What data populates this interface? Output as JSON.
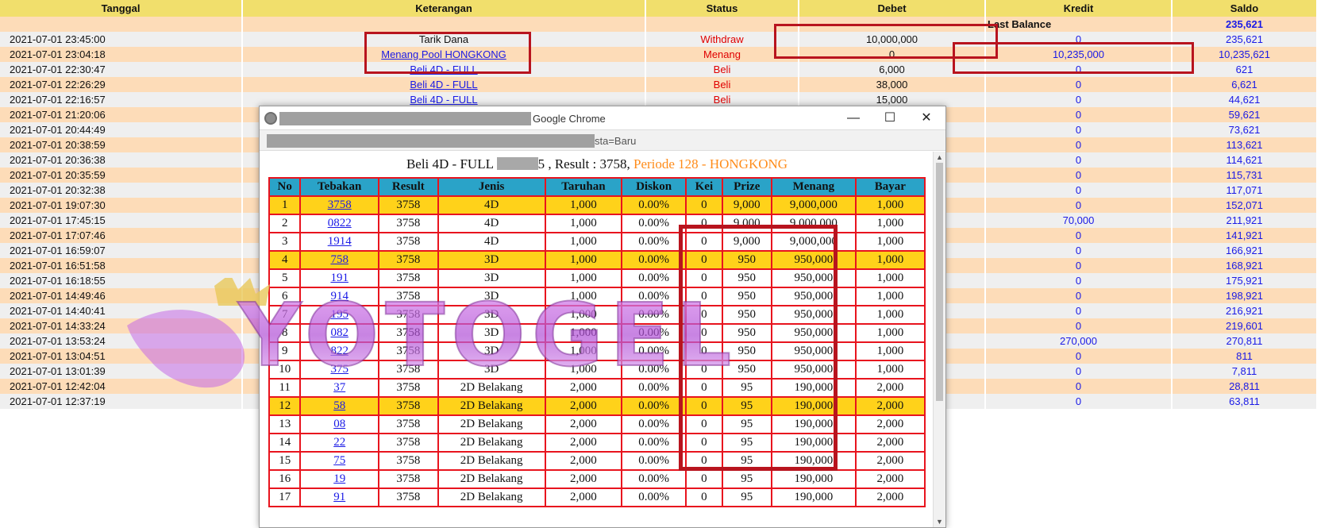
{
  "ledger": {
    "headers": [
      "Tanggal",
      "Keterangan",
      "Status",
      "Debet",
      "Kredit",
      "Saldo"
    ],
    "last_balance": {
      "label": "Last Balance",
      "value": "235,621"
    },
    "rows": [
      {
        "date": "2021-07-01 23:45:00",
        "ket": "Tarik Dana",
        "link": false,
        "status": "Withdraw",
        "debet": "10,000,000",
        "kredit": "0",
        "saldo": "235,621"
      },
      {
        "date": "2021-07-01 23:04:18",
        "ket": "Menang Pool HONGKONG",
        "link": true,
        "status": "Menang",
        "debet": "0",
        "kredit": "10,235,000",
        "saldo": "10,235,621"
      },
      {
        "date": "2021-07-01 22:30:47",
        "ket": "Beli 4D - FULL",
        "link": true,
        "status": "Beli",
        "debet": "6,000",
        "kredit": "0",
        "saldo": "621"
      },
      {
        "date": "2021-07-01 22:26:29",
        "ket": "Beli 4D - FULL",
        "link": true,
        "status": "Beli",
        "debet": "38,000",
        "kredit": "0",
        "saldo": "6,621"
      },
      {
        "date": "2021-07-01 22:16:57",
        "ket": "Beli 4D - FULL",
        "link": true,
        "status": "Beli",
        "debet": "15,000",
        "kredit": "0",
        "saldo": "44,621"
      },
      {
        "date": "2021-07-01 21:20:06",
        "ket": "",
        "link": false,
        "status": "",
        "debet": "",
        "kredit": "0",
        "saldo": "59,621"
      },
      {
        "date": "2021-07-01 20:44:49",
        "ket": "",
        "link": false,
        "status": "",
        "debet": "",
        "kredit": "0",
        "saldo": "73,621"
      },
      {
        "date": "2021-07-01 20:38:59",
        "ket": "",
        "link": false,
        "status": "",
        "debet": "",
        "kredit": "0",
        "saldo": "113,621"
      },
      {
        "date": "2021-07-01 20:36:38",
        "ket": "",
        "link": false,
        "status": "",
        "debet": "",
        "kredit": "0",
        "saldo": "114,621"
      },
      {
        "date": "2021-07-01 20:35:59",
        "ket": "",
        "link": false,
        "status": "",
        "debet": "",
        "kredit": "0",
        "saldo": "115,731"
      },
      {
        "date": "2021-07-01 20:32:38",
        "ket": "",
        "link": false,
        "status": "",
        "debet": "",
        "kredit": "0",
        "saldo": "117,071"
      },
      {
        "date": "2021-07-01 19:07:30",
        "ket": "",
        "link": false,
        "status": "",
        "debet": "",
        "kredit": "0",
        "saldo": "152,071"
      },
      {
        "date": "2021-07-01 17:45:15",
        "ket": "",
        "link": false,
        "status": "",
        "debet": "",
        "kredit": "70,000",
        "saldo": "211,921"
      },
      {
        "date": "2021-07-01 17:07:46",
        "ket": "",
        "link": false,
        "status": "",
        "debet": "",
        "kredit": "0",
        "saldo": "141,921"
      },
      {
        "date": "2021-07-01 16:59:07",
        "ket": "",
        "link": false,
        "status": "",
        "debet": "",
        "kredit": "0",
        "saldo": "166,921"
      },
      {
        "date": "2021-07-01 16:51:58",
        "ket": "",
        "link": false,
        "status": "",
        "debet": "",
        "kredit": "0",
        "saldo": "168,921"
      },
      {
        "date": "2021-07-01 16:18:55",
        "ket": "",
        "link": false,
        "status": "",
        "debet": "",
        "kredit": "0",
        "saldo": "175,921"
      },
      {
        "date": "2021-07-01 14:49:46",
        "ket": "",
        "link": false,
        "status": "",
        "debet": "",
        "kredit": "0",
        "saldo": "198,921"
      },
      {
        "date": "2021-07-01 14:40:41",
        "ket": "",
        "link": false,
        "status": "",
        "debet": "",
        "kredit": "0",
        "saldo": "216,921"
      },
      {
        "date": "2021-07-01 14:33:24",
        "ket": "",
        "link": false,
        "status": "",
        "debet": "",
        "kredit": "0",
        "saldo": "219,601"
      },
      {
        "date": "2021-07-01 13:53:24",
        "ket": "",
        "link": false,
        "status": "",
        "debet": "",
        "kredit": "270,000",
        "saldo": "270,811"
      },
      {
        "date": "2021-07-01 13:04:51",
        "ket": "",
        "link": false,
        "status": "",
        "debet": "",
        "kredit": "0",
        "saldo": "811"
      },
      {
        "date": "2021-07-01 13:01:39",
        "ket": "",
        "link": false,
        "status": "",
        "debet": "",
        "kredit": "0",
        "saldo": "7,811"
      },
      {
        "date": "2021-07-01 12:42:04",
        "ket": "",
        "link": false,
        "status": "",
        "debet": "",
        "kredit": "0",
        "saldo": "28,811"
      },
      {
        "date": "2021-07-01 12:37:19",
        "ket": "",
        "link": false,
        "status": "",
        "debet": "",
        "kredit": "0",
        "saldo": "63,811"
      }
    ]
  },
  "popup": {
    "window_title": "Google Chrome",
    "url_suffix": "sta=Baru",
    "window_buttons": {
      "minimize": "—",
      "maximize": "☐",
      "close": "✕"
    },
    "heading": {
      "prefix": "Beli 4D - FULL",
      "mid": "5 , Result : 3758,",
      "periode": "Periode 128 - HONGKONG"
    },
    "columns": [
      "No",
      "Tebakan",
      "Result",
      "Jenis",
      "Taruhan",
      "Diskon",
      "Kei",
      "Prize",
      "Menang",
      "Bayar"
    ],
    "rows": [
      {
        "no": "1",
        "tebakan": "3758",
        "result": "3758",
        "jenis": "4D",
        "taruhan": "1,000",
        "diskon": "0.00%",
        "kei": "0",
        "prize": "9,000",
        "menang": "9,000,000",
        "bayar": "1,000",
        "hl": true
      },
      {
        "no": "2",
        "tebakan": "0822",
        "result": "3758",
        "jenis": "4D",
        "taruhan": "1,000",
        "diskon": "0.00%",
        "kei": "0",
        "prize": "9,000",
        "menang": "9,000,000",
        "bayar": "1,000",
        "hl": false
      },
      {
        "no": "3",
        "tebakan": "1914",
        "result": "3758",
        "jenis": "4D",
        "taruhan": "1,000",
        "diskon": "0.00%",
        "kei": "0",
        "prize": "9,000",
        "menang": "9,000,000",
        "bayar": "1,000",
        "hl": false
      },
      {
        "no": "4",
        "tebakan": "758",
        "result": "3758",
        "jenis": "3D",
        "taruhan": "1,000",
        "diskon": "0.00%",
        "kei": "0",
        "prize": "950",
        "menang": "950,000",
        "bayar": "1,000",
        "hl": true
      },
      {
        "no": "5",
        "tebakan": "191",
        "result": "3758",
        "jenis": "3D",
        "taruhan": "1,000",
        "diskon": "0.00%",
        "kei": "0",
        "prize": "950",
        "menang": "950,000",
        "bayar": "1,000",
        "hl": false
      },
      {
        "no": "6",
        "tebakan": "914",
        "result": "3758",
        "jenis": "3D",
        "taruhan": "1,000",
        "diskon": "0.00%",
        "kei": "0",
        "prize": "950",
        "menang": "950,000",
        "bayar": "1,000",
        "hl": false
      },
      {
        "no": "7",
        "tebakan": "195",
        "result": "3758",
        "jenis": "3D",
        "taruhan": "1,000",
        "diskon": "0.00%",
        "kei": "0",
        "prize": "950",
        "menang": "950,000",
        "bayar": "1,000",
        "hl": false
      },
      {
        "no": "8",
        "tebakan": "082",
        "result": "3758",
        "jenis": "3D",
        "taruhan": "1,000",
        "diskon": "0.00%",
        "kei": "0",
        "prize": "950",
        "menang": "950,000",
        "bayar": "1,000",
        "hl": false
      },
      {
        "no": "9",
        "tebakan": "822",
        "result": "3758",
        "jenis": "3D",
        "taruhan": "1,000",
        "diskon": "0.00%",
        "kei": "0",
        "prize": "950",
        "menang": "950,000",
        "bayar": "1,000",
        "hl": false
      },
      {
        "no": "10",
        "tebakan": "375",
        "result": "3758",
        "jenis": "3D",
        "taruhan": "1,000",
        "diskon": "0.00%",
        "kei": "0",
        "prize": "950",
        "menang": "950,000",
        "bayar": "1,000",
        "hl": false
      },
      {
        "no": "11",
        "tebakan": "37",
        "result": "3758",
        "jenis": "2D Belakang",
        "taruhan": "2,000",
        "diskon": "0.00%",
        "kei": "0",
        "prize": "95",
        "menang": "190,000",
        "bayar": "2,000",
        "hl": false
      },
      {
        "no": "12",
        "tebakan": "58",
        "result": "3758",
        "jenis": "2D Belakang",
        "taruhan": "2,000",
        "diskon": "0.00%",
        "kei": "0",
        "prize": "95",
        "menang": "190,000",
        "bayar": "2,000",
        "hl": true
      },
      {
        "no": "13",
        "tebakan": "08",
        "result": "3758",
        "jenis": "2D Belakang",
        "taruhan": "2,000",
        "diskon": "0.00%",
        "kei": "0",
        "prize": "95",
        "menang": "190,000",
        "bayar": "2,000",
        "hl": false
      },
      {
        "no": "14",
        "tebakan": "22",
        "result": "3758",
        "jenis": "2D Belakang",
        "taruhan": "2,000",
        "diskon": "0.00%",
        "kei": "0",
        "prize": "95",
        "menang": "190,000",
        "bayar": "2,000",
        "hl": false
      },
      {
        "no": "15",
        "tebakan": "75",
        "result": "3758",
        "jenis": "2D Belakang",
        "taruhan": "2,000",
        "diskon": "0.00%",
        "kei": "0",
        "prize": "95",
        "menang": "190,000",
        "bayar": "2,000",
        "hl": false
      },
      {
        "no": "16",
        "tebakan": "19",
        "result": "3758",
        "jenis": "2D Belakang",
        "taruhan": "2,000",
        "diskon": "0.00%",
        "kei": "0",
        "prize": "95",
        "menang": "190,000",
        "bayar": "2,000",
        "hl": false
      },
      {
        "no": "17",
        "tebakan": "91",
        "result": "3758",
        "jenis": "2D Belakang",
        "taruhan": "2,000",
        "diskon": "0.00%",
        "kei": "0",
        "prize": "95",
        "menang": "190,000",
        "bayar": "2,000",
        "hl": false
      }
    ]
  },
  "watermark": {
    "text": "YOTOGEL"
  },
  "colors": {
    "header_bg": "#f1df6c",
    "row_odd": "#efefef",
    "row_even": "#fddcb8",
    "status_red": "#e00000",
    "link_blue": "#1a1ae6",
    "annot_red": "#b8141e",
    "popup_header": "#2aa3c8",
    "popup_highlight": "#ffd21a",
    "periode_orange": "#ff8c1a"
  }
}
